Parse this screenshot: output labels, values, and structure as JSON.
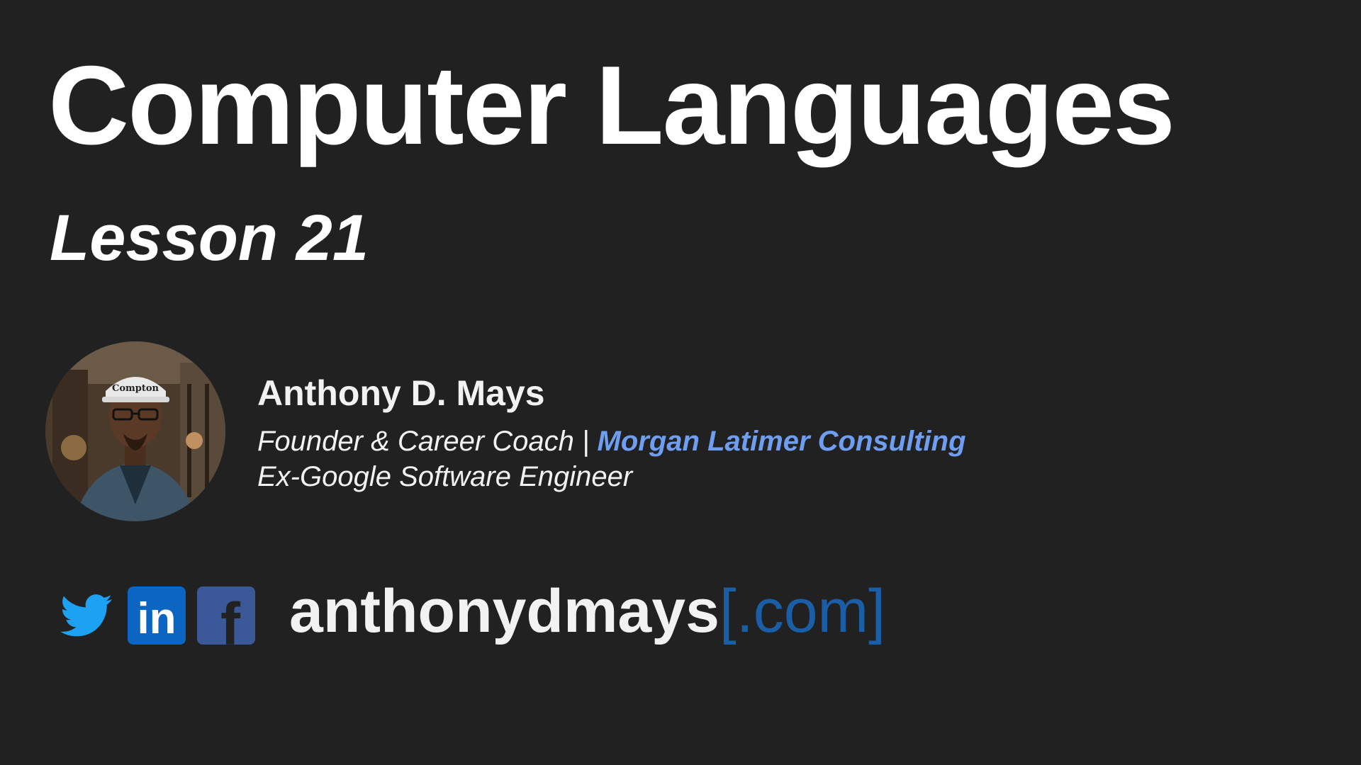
{
  "slide": {
    "title": "Computer Languages",
    "subtitle": "Lesson 21"
  },
  "presenter": {
    "name": "Anthony D. Mays",
    "role_prefix": "Founder & Career Coach | ",
    "company": "Morgan Latimer Consulting",
    "previous_role": "Ex-Google Software Engineer",
    "avatar_icon": "presenter-photo",
    "cap_text": "Compton"
  },
  "socials": [
    {
      "icon": "twitter-icon",
      "color": "#1da1f2"
    },
    {
      "icon": "linkedin-icon",
      "color": "#0a66c2",
      "text": "in"
    },
    {
      "icon": "facebook-icon",
      "color": "#3b5998",
      "text": "f"
    }
  ],
  "website": {
    "name": "anthonydmays",
    "suffix": "[.com]"
  },
  "colors": {
    "background": "#212121",
    "text": "#ffffff",
    "company": "#6f9df0",
    "website_suffix": "#1a5ea8"
  }
}
